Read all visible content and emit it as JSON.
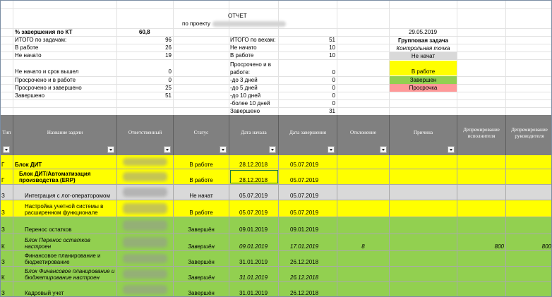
{
  "report": {
    "title": "ОТЧЕТ",
    "project_label": "по проекту",
    "date": "29.05.2019"
  },
  "left_stats": [
    {
      "label": "% завершения по КТ",
      "value": "60,8",
      "bold": true
    },
    {
      "label": "ИТОГО по задачам:",
      "value": "96"
    },
    {
      "label": "В работе",
      "value": "26"
    },
    {
      "label": "Не начато",
      "value": "19"
    },
    {
      "label": "Не начато и срок вышел",
      "value": "0"
    },
    {
      "label": "Просрочено и в работе",
      "value": "0"
    },
    {
      "label": "Просрочено и завершено",
      "value": "25"
    },
    {
      "label": "Завершено",
      "value": "51"
    }
  ],
  "middle_stats": [
    {
      "label": "ИТОГО по вехам:",
      "value": "51"
    },
    {
      "label": "Не начато",
      "value": "10"
    },
    {
      "label": "В работе",
      "value": "10"
    },
    {
      "label_line1": "Просрочено и в",
      "label_line2": "работе:",
      "value": "0"
    },
    {
      "label": "-до 3 дней",
      "value": "0"
    },
    {
      "label": "-до 5 дней",
      "value": "0"
    },
    {
      "label": "-до 10 дней",
      "value": "0"
    },
    {
      "label": "-более 10 дней",
      "value": "0"
    },
    {
      "label": "Завершено",
      "value": "31"
    }
  ],
  "legend": {
    "group_task": "Групповая задача",
    "control_point": "Контрольная точка",
    "not_started": "Не начат",
    "in_work": "В работе",
    "done": "Завершен",
    "overdue": "Просрочка",
    "colors": {
      "gray": "#d9d9d9",
      "yellow": "#ffff00",
      "green": "#92d050",
      "red": "#ff9999"
    }
  },
  "columns": [
    {
      "label": "Тип"
    },
    {
      "label": "Название задачи"
    },
    {
      "label": "Ответственный"
    },
    {
      "label": "Статус"
    },
    {
      "label": "Дата начала"
    },
    {
      "label": "Дата завершения"
    },
    {
      "label": "Отклонение"
    },
    {
      "label": "Причина"
    },
    {
      "label": "Депремирование исполнителя"
    },
    {
      "label": "Депремирование руководителя"
    }
  ],
  "rows": [
    {
      "type": "Г",
      "name": "Блок ДИТ",
      "status": "В работе",
      "start": "28.12.2018",
      "end": "05.07.2019",
      "deviation": "",
      "reason": "",
      "dep_exec": "",
      "dep_mgr": "",
      "color": "#ffff00",
      "bold": true,
      "italic": false
    },
    {
      "type": "Г",
      "name": "Блок ДИТ/Автоматизация производства (ERP)",
      "status": "В работе",
      "start": "28.12.2018",
      "end": "05.07.2019",
      "deviation": "",
      "reason": "",
      "dep_exec": "",
      "dep_mgr": "",
      "color": "#ffff00",
      "bold": true,
      "italic": false,
      "indent": true
    },
    {
      "type": "З",
      "name": "Интеграция с лог-операторомом",
      "status": "Не начат",
      "start": "05.07.2019",
      "end": "05.07.2019",
      "deviation": "",
      "reason": "",
      "dep_exec": "",
      "dep_mgr": "",
      "color": "#d9d9d9",
      "bold": false,
      "italic": false,
      "indent": true
    },
    {
      "type": "З",
      "name": "Настройка учетной системы в расширенном функционале",
      "status": "В работе",
      "start": "05.07.2019",
      "end": "05.07.2019",
      "deviation": "",
      "reason": "",
      "dep_exec": "",
      "dep_mgr": "",
      "color": "#ffff00",
      "bold": false,
      "italic": false,
      "indent": true
    },
    {
      "type": "З",
      "name": "Перенос остатков",
      "status": "Завершён",
      "start": "09.01.2019",
      "end": "09.01.2019",
      "deviation": "",
      "reason": "",
      "dep_exec": "",
      "dep_mgr": "",
      "color": "#92d050",
      "bold": false,
      "italic": false,
      "indent": true
    },
    {
      "type": "К",
      "name": "Блок Перенос остатков настроен",
      "status": "Завершён",
      "start": "09.01.2019",
      "end": "17.01.2019",
      "deviation": "8",
      "reason": "",
      "dep_exec": "800",
      "dep_mgr": "800",
      "color": "#92d050",
      "bold": false,
      "italic": true,
      "indent": true
    },
    {
      "type": "З",
      "name": "Финансовое планирование и бюджетирование",
      "status": "Завершён",
      "start": "31.01.2019",
      "end": "26.12.2018",
      "deviation": "",
      "reason": "",
      "dep_exec": "",
      "dep_mgr": "",
      "color": "#92d050",
      "bold": false,
      "italic": false,
      "indent": true
    },
    {
      "type": "К",
      "name": "Блок Финансовое планирование и бюджетирование настроен",
      "status": "Завершён",
      "start": "31.01.2019",
      "end": "26.12.2018",
      "deviation": "",
      "reason": "",
      "dep_exec": "",
      "dep_mgr": "",
      "color": "#92d050",
      "bold": false,
      "italic": true,
      "indent": true
    },
    {
      "type": "З",
      "name": "Кадровый учет",
      "status": "Завершён",
      "start": "31.01.2019",
      "end": "26.12.2018",
      "deviation": "",
      "reason": "",
      "dep_exec": "",
      "dep_mgr": "",
      "color": "#92d050",
      "bold": false,
      "italic": false,
      "indent": true
    }
  ]
}
